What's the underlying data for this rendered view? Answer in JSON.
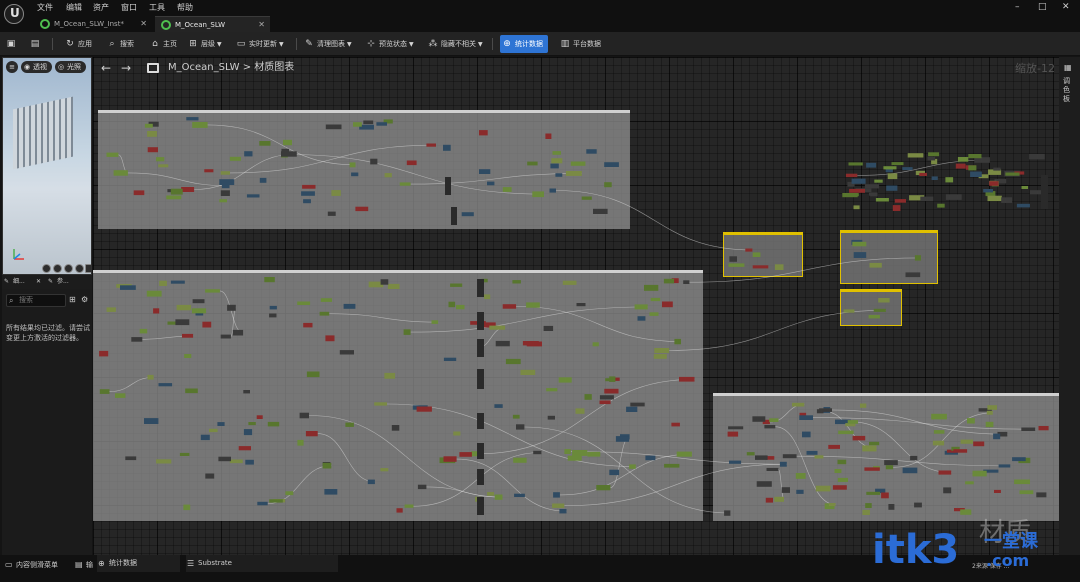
{
  "menu": [
    "文件",
    "编辑",
    "资产",
    "窗口",
    "工具",
    "帮助"
  ],
  "window_controls": [
    "–",
    "□",
    "✕"
  ],
  "tabs": [
    {
      "label": "M_Ocean_SLW_Inst*"
    },
    {
      "label": "M_Ocean_SLW"
    }
  ],
  "toolbar": {
    "apply": "应用",
    "search": "搜索",
    "home": "主页",
    "hierarchy": "层级",
    "live_update": "实时更新",
    "clean_graph": "清理图表",
    "preview_state": "预览状态",
    "hide_unrelated": "隐藏不相关",
    "stats": "统计数据",
    "platform_stats": "平台数据"
  },
  "viewport": {
    "perspective": "透视",
    "lit": "光照"
  },
  "details": {
    "tab1": "细...",
    "tab2": "参...",
    "search_placeholder": "搜索",
    "filter_message": "所有结果均已过滤。请尝试变更上方激活的过滤器。"
  },
  "graph": {
    "breadcrumb_asset": "M_Ocean_SLW",
    "breadcrumb_sep": ">",
    "breadcrumb_view": "材质图表",
    "zoom": "缩放-12"
  },
  "rightbar": {
    "label": "调色板"
  },
  "bottombar": {
    "content_drawer": "内容侧滑菜单",
    "output": "输出...",
    "stats_tab": "统计数据",
    "substrate_tab": "Substrate",
    "status": "2来源 保存 ..."
  },
  "watermark": {
    "text": "材质",
    "brand": "itk3",
    "brand_cn": "一堂课",
    "brand_domain": ".com"
  },
  "colors": {
    "accent": "#2e74d4",
    "node_green": "#6a8a3a",
    "comment_gray": "#959595"
  }
}
